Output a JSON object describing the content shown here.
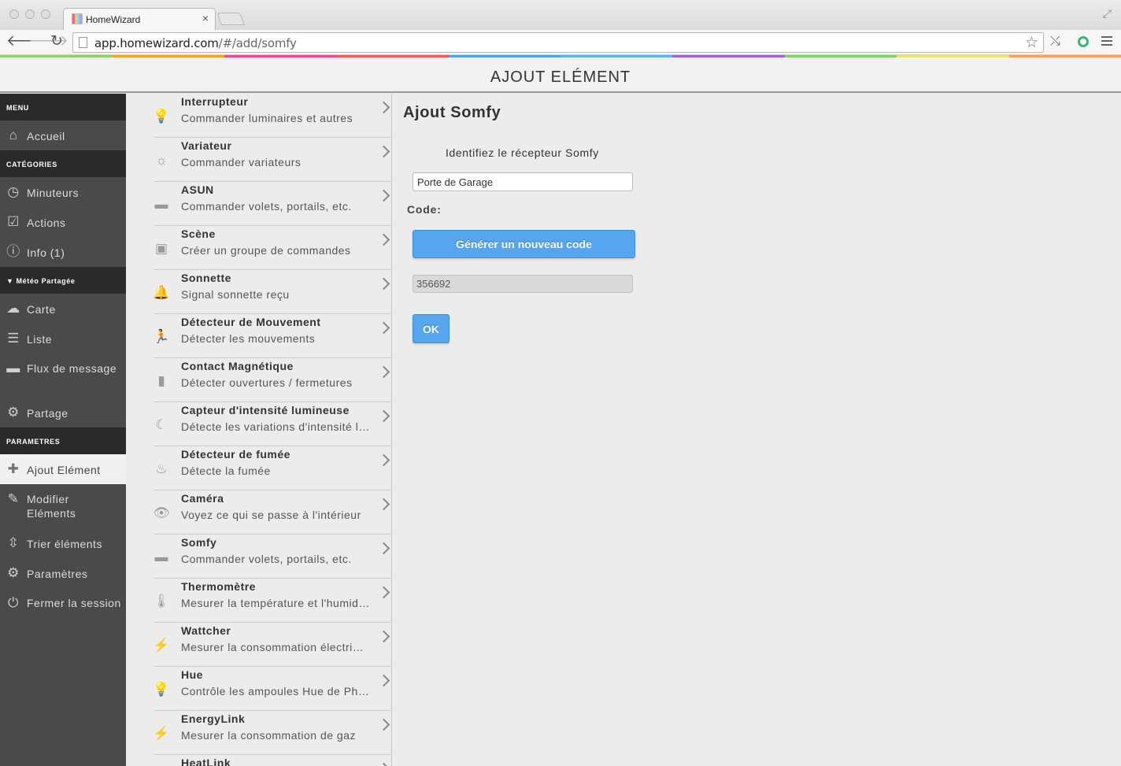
{
  "browser": {
    "tab_title": "HomeWizard",
    "tab_close": "×",
    "url_host": "app.homewizard.com",
    "url_path": "/#/add/somfy",
    "back_icon": "arrow-left-icon",
    "forward_icon": "arrow-right-icon",
    "reload_icon": "reload-icon",
    "star_icon": "star-icon"
  },
  "header": {
    "title": "AJOUT ELÉMENT",
    "rainbow_colors": [
      "#8bd36b",
      "#f5a623",
      "#e84b8a",
      "#f25a5a",
      "#4fa3e0",
      "#58b6e8",
      "#a35fd6",
      "#7fd36b",
      "#f0e36a",
      "#f5a35a"
    ]
  },
  "sidebar": {
    "sections": [
      {
        "label": "MENU",
        "items": [
          {
            "label": "Accueil",
            "icon": "home-icon"
          }
        ]
      },
      {
        "label": "CATÉGORIES",
        "items": [
          {
            "label": "Minuteurs",
            "icon": "clock-icon"
          },
          {
            "label": "Actions",
            "icon": "checkbox-icon"
          },
          {
            "label": "Info (1)",
            "icon": "info-icon"
          }
        ]
      },
      {
        "label": "Météo Partagée",
        "caret": "▼",
        "items": [
          {
            "label": "Carte",
            "icon": "cloud-icon"
          },
          {
            "label": "Liste",
            "icon": "list-icon"
          },
          {
            "label": "Flux de message",
            "icon": "chat-icon"
          },
          {
            "label": "Partage",
            "icon": "gears-icon"
          }
        ]
      },
      {
        "label": "PARAMETRES",
        "items": [
          {
            "label": "Ajout Elément",
            "icon": "plus-icon"
          },
          {
            "label": "Modifier Eléments",
            "icon": "pencil-icon"
          },
          {
            "label": "Trier éléments",
            "icon": "sort-icon"
          },
          {
            "label": "Paramètres",
            "icon": "settings-icon"
          },
          {
            "label": "Fermer la session",
            "icon": "power-icon"
          }
        ]
      }
    ]
  },
  "devices": [
    {
      "title": "Interrupteur",
      "subtitle": "Commander luminaires et autres",
      "icon": "bulb-icon"
    },
    {
      "title": "Variateur",
      "subtitle": "Commander variateurs",
      "icon": "sun-icon"
    },
    {
      "title": "ASUN",
      "subtitle": "Commander volets, portails, etc.",
      "icon": "shutter-icon"
    },
    {
      "title": "Scène",
      "subtitle": "Créer un groupe de commandes",
      "icon": "picture-icon"
    },
    {
      "title": "Sonnette",
      "subtitle": "Signal sonnette reçu",
      "icon": "bell-icon"
    },
    {
      "title": "Détecteur de Mouvement",
      "subtitle": "Détecter les mouvements",
      "icon": "running-icon"
    },
    {
      "title": "Contact Magnétique",
      "subtitle": "Détecter ouvertures / fermetures",
      "icon": "door-icon"
    },
    {
      "title": "Capteur d'intensité lumineuse",
      "subtitle": "Détecte les variations d'intensité lumineuse",
      "icon": "moon-icon"
    },
    {
      "title": "Détecteur de fumée",
      "subtitle": "Détecte la fumée",
      "icon": "flame-icon"
    },
    {
      "title": "Caméra",
      "subtitle": "Voyez ce qui se passe à l'intérieur",
      "icon": "eye-icon"
    },
    {
      "title": "Somfy",
      "subtitle": "Commander volets, portails, etc.",
      "icon": "shutter-icon"
    },
    {
      "title": "Thermomètre",
      "subtitle": "Mesurer la température et l'humidité",
      "icon": "thermometer-icon"
    },
    {
      "title": "Wattcher",
      "subtitle": "Mesurer la consommation électrique",
      "icon": "bolt-icon"
    },
    {
      "title": "Hue",
      "subtitle": "Contrôle les ampoules Hue de Philips",
      "icon": "bulb-icon"
    },
    {
      "title": "EnergyLink",
      "subtitle": "Mesurer la consommation de gaz",
      "icon": "bolt-icon"
    },
    {
      "title": "HeatLink",
      "subtitle": "",
      "icon": "heat-icon"
    }
  ],
  "main": {
    "title": "Ajout Somfy",
    "prompt": "Identifiez le récepteur Somfy",
    "name_value": "Porte de Garage",
    "code_label": "Code:",
    "generate_label": "Générer un nouveau code",
    "code_value": "356692",
    "ok_label": "OK",
    "accent_color": "#55a6ee"
  }
}
